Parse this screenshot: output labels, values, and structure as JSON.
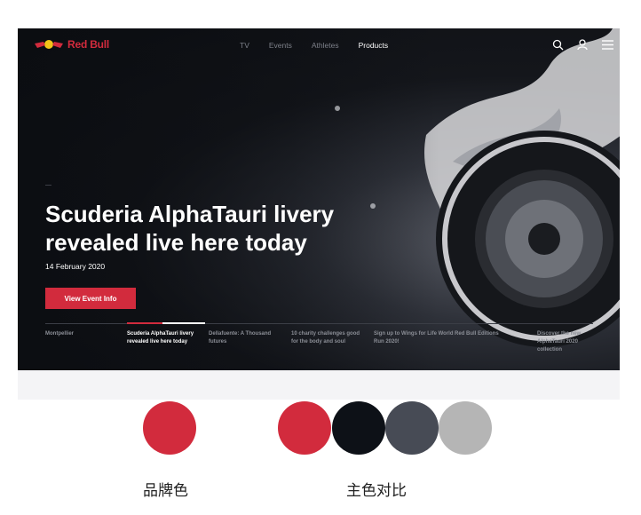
{
  "nav": {
    "brand": "Red Bull",
    "links": [
      {
        "label": "TV",
        "active": false
      },
      {
        "label": "Events",
        "active": false
      },
      {
        "label": "Athletes",
        "active": false
      },
      {
        "label": "Products",
        "active": true
      }
    ],
    "icons": [
      "search-icon",
      "user-icon",
      "menu-icon"
    ]
  },
  "hero": {
    "breadcrumb": "—",
    "title": "Scuderia AlphaTauri livery revealed live here today",
    "date": "14 February 2020",
    "cta_label": "View Event Info"
  },
  "news_tabs": [
    {
      "label": "Montpellier",
      "active": false
    },
    {
      "label": "Scuderia AlphaTauri livery revealed live here today",
      "active": true
    },
    {
      "label": "Dellafuente: A Thousand futures",
      "active": false
    },
    {
      "label": "10 charity challenges good for the body and soul",
      "active": false
    },
    {
      "label": "Sign up to Wings for Life World Run 2020!",
      "active": false
    },
    {
      "label": "Red Bull Editions",
      "active": false
    },
    {
      "label": "Discover the new AlphaTauri 2020 collection",
      "active": false
    }
  ],
  "palette": {
    "brand": {
      "caption": "品牌色",
      "colors": [
        "#d22b3d"
      ]
    },
    "contrast": {
      "caption": "主色对比",
      "colors": [
        "#d22b3d",
        "#0d1117",
        "#474b55",
        "#b5b5b5"
      ]
    }
  }
}
